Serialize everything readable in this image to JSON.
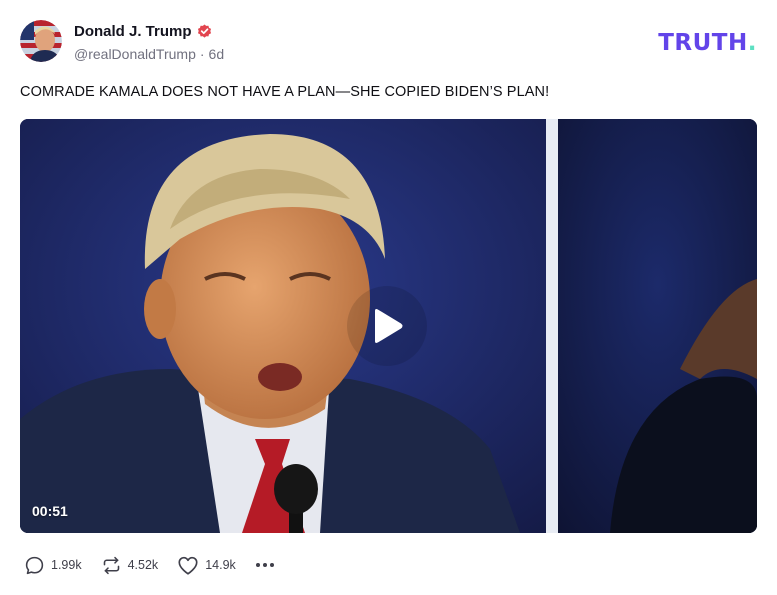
{
  "author": {
    "display_name": "Donald J. Trump",
    "handle": "@realDonaldTrump",
    "separator": "·",
    "time_ago": "6d",
    "verified_icon": "verified-badge-icon"
  },
  "brand": {
    "logo_text": "TRUTH",
    "logo_dot": ".",
    "color": "#6244e9",
    "dot_color": "#5de0c2"
  },
  "post": {
    "text": "COMRADE KAMALA DOES NOT HAVE A PLAN—SHE COPIED BIDEN’S PLAN!"
  },
  "video": {
    "duration": "00:51",
    "play_icon": "play-icon"
  },
  "actions": {
    "replies": "1.99k",
    "retruths": "4.52k",
    "likes": "14.9k",
    "more_icon": "more-horizontal-icon"
  },
  "colors": {
    "verified": "#e2454f",
    "text_muted": "#71717f"
  }
}
